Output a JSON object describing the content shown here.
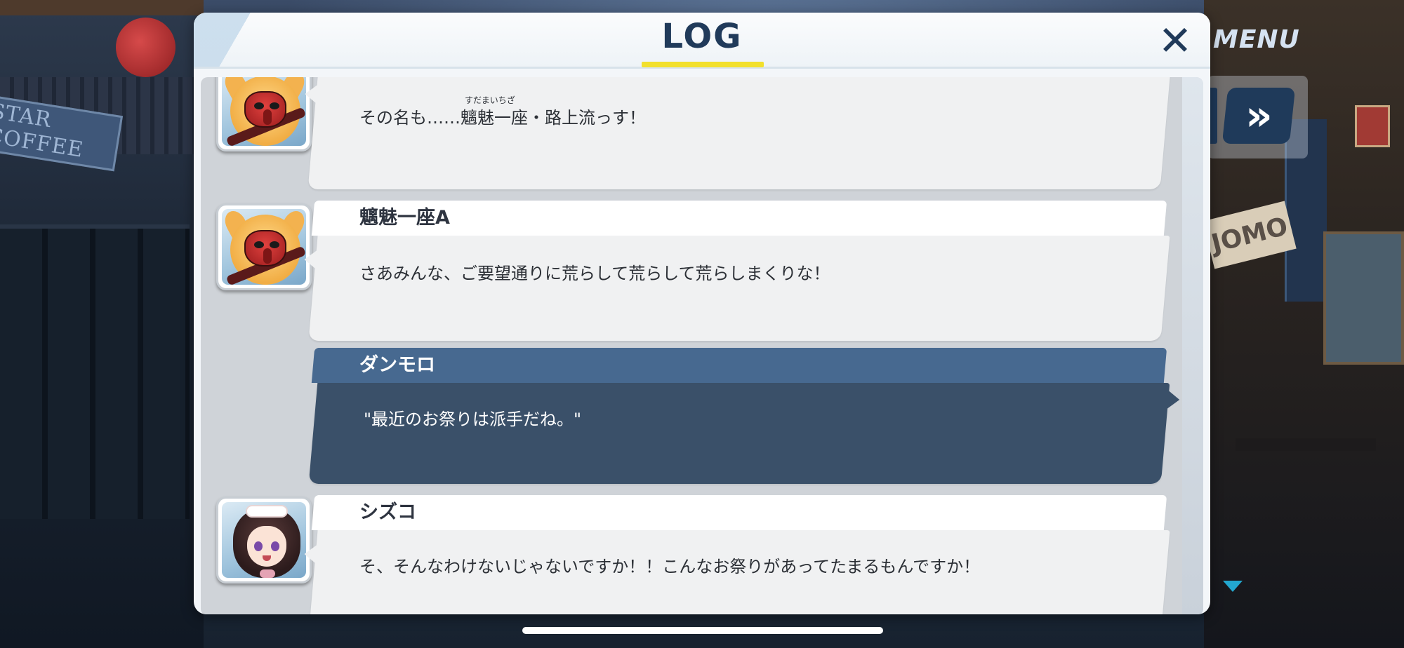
{
  "hud": {
    "menu_label": "MENU",
    "fast_forward_label": "»"
  },
  "log": {
    "title": "LOG",
    "close_label": "✕",
    "accent_color": "#f2e02c",
    "entries": [
      {
        "speaker": "",
        "portrait": "fox-tengu-mask-portrait",
        "text_before_ruby": "その名も……",
        "ruby_base": "魑魅一座",
        "ruby_reading": "すだまいちざ",
        "text_after_ruby": "・路上流っす！"
      },
      {
        "speaker": "魑魅一座A",
        "portrait": "fox-tengu-mask-portrait",
        "text": "さあみんな、ご要望通りに荒らして荒らして荒らしまくりな！"
      },
      {
        "speaker": "ダンモロ",
        "portrait": "",
        "is_player": true,
        "text": "\"最近のお祭りは派手だね。\""
      },
      {
        "speaker": "シズコ",
        "portrait": "maid-girl-portrait",
        "text": "そ、そんなわけないじゃないですか！！こんなお祭りがあってたまるもんですか！"
      }
    ]
  },
  "background": {
    "left_sign_text": "STAR COFFEE",
    "right_sign_text": "JOMO"
  }
}
